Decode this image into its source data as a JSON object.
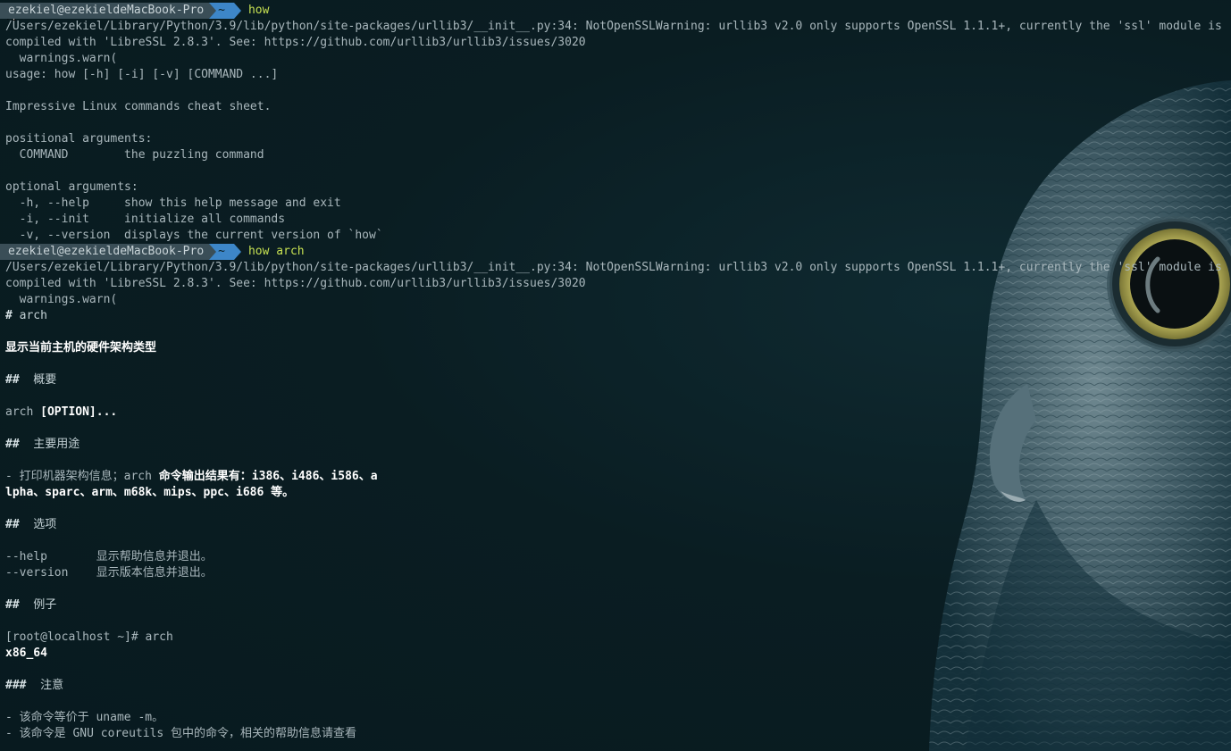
{
  "prompt": {
    "host": "ezekiel@ezekieldeMacBook-Pro",
    "dir": "~",
    "cmd1": "how",
    "cmd2": "how arch"
  },
  "output1": {
    "warn1": "/Users/ezekiel/Library/Python/3.9/lib/python/site-packages/urllib3/__init__.py:34: NotOpenSSLWarning: urllib3 v2.0 only supports OpenSSL 1.1.1+, currently the 'ssl' module is",
    "warn2": "compiled with 'LibreSSL 2.8.3'. See: https://github.com/urllib3/urllib3/issues/3020",
    "warn3": "  warnings.warn(",
    "usage": "usage: how [-h] [-i] [-v] [COMMAND ...]",
    "desc": "Impressive Linux commands cheat sheet.",
    "pos_header": "positional arguments:",
    "pos_command": "  COMMAND        the puzzling command",
    "opt_header": "optional arguments:",
    "opt_help": "  -h, --help     show this help message and exit",
    "opt_init": "  -i, --init     initialize all commands",
    "opt_version": "  -v, --version  displays the current version of `how`"
  },
  "output2": {
    "warn1": "/Users/ezekiel/Library/Python/3.9/lib/python/site-packages/urllib3/__init__.py:34: NotOpenSSLWarning: urllib3 v2.0 only supports OpenSSL 1.1.1+, currently the 'ssl' module is",
    "warn2": "compiled with 'LibreSSL 2.8.3'. See: https://github.com/urllib3/urllib3/issues/3020",
    "warn3": "  warnings.warn(",
    "title_hash": "#",
    "title": " arch",
    "summary": "显示当前主机的硬件架构类型",
    "h_overview_hash": "##",
    "h_overview": "  概要",
    "syntax_cmd": "arch ",
    "syntax_opt": "[OPTION]...",
    "h_usage_hash": "##",
    "h_usage": "  主要用途",
    "usage_pre": "- 打印机器架构信息；arch ",
    "usage_bold1": "命令输出结果有：i386、i486、i586、a",
    "usage_bold2": "lpha、sparc、arm、m68k、mips、ppc、i686 等。",
    "h_options_hash": "##",
    "h_options": "  选项",
    "opt_help": "--help       显示帮助信息并退出。",
    "opt_version": "--version    显示版本信息并退出。",
    "h_example_hash": "##",
    "h_example": "  例子",
    "example_cmd": "[root@localhost ~]# arch",
    "example_out": "x86_64",
    "h_note_hash": "###",
    "h_note": "  注意",
    "note1": "- 该命令等价于 uname -m。",
    "note2": "- 该命令是 GNU coreutils 包中的命令，相关的帮助信息请查看"
  },
  "colors": {
    "background": "#0b1e23",
    "prompt_host_bg": "#3a4e57",
    "prompt_dir_bg": "#3d86c8",
    "command": "#c6e052",
    "text": "#a9b7bc",
    "owl_eye_ring": "#b8b25a"
  },
  "icons": {
    "cursor": "mouse-pointer-icon",
    "wallpaper": "owl-wallpaper"
  }
}
